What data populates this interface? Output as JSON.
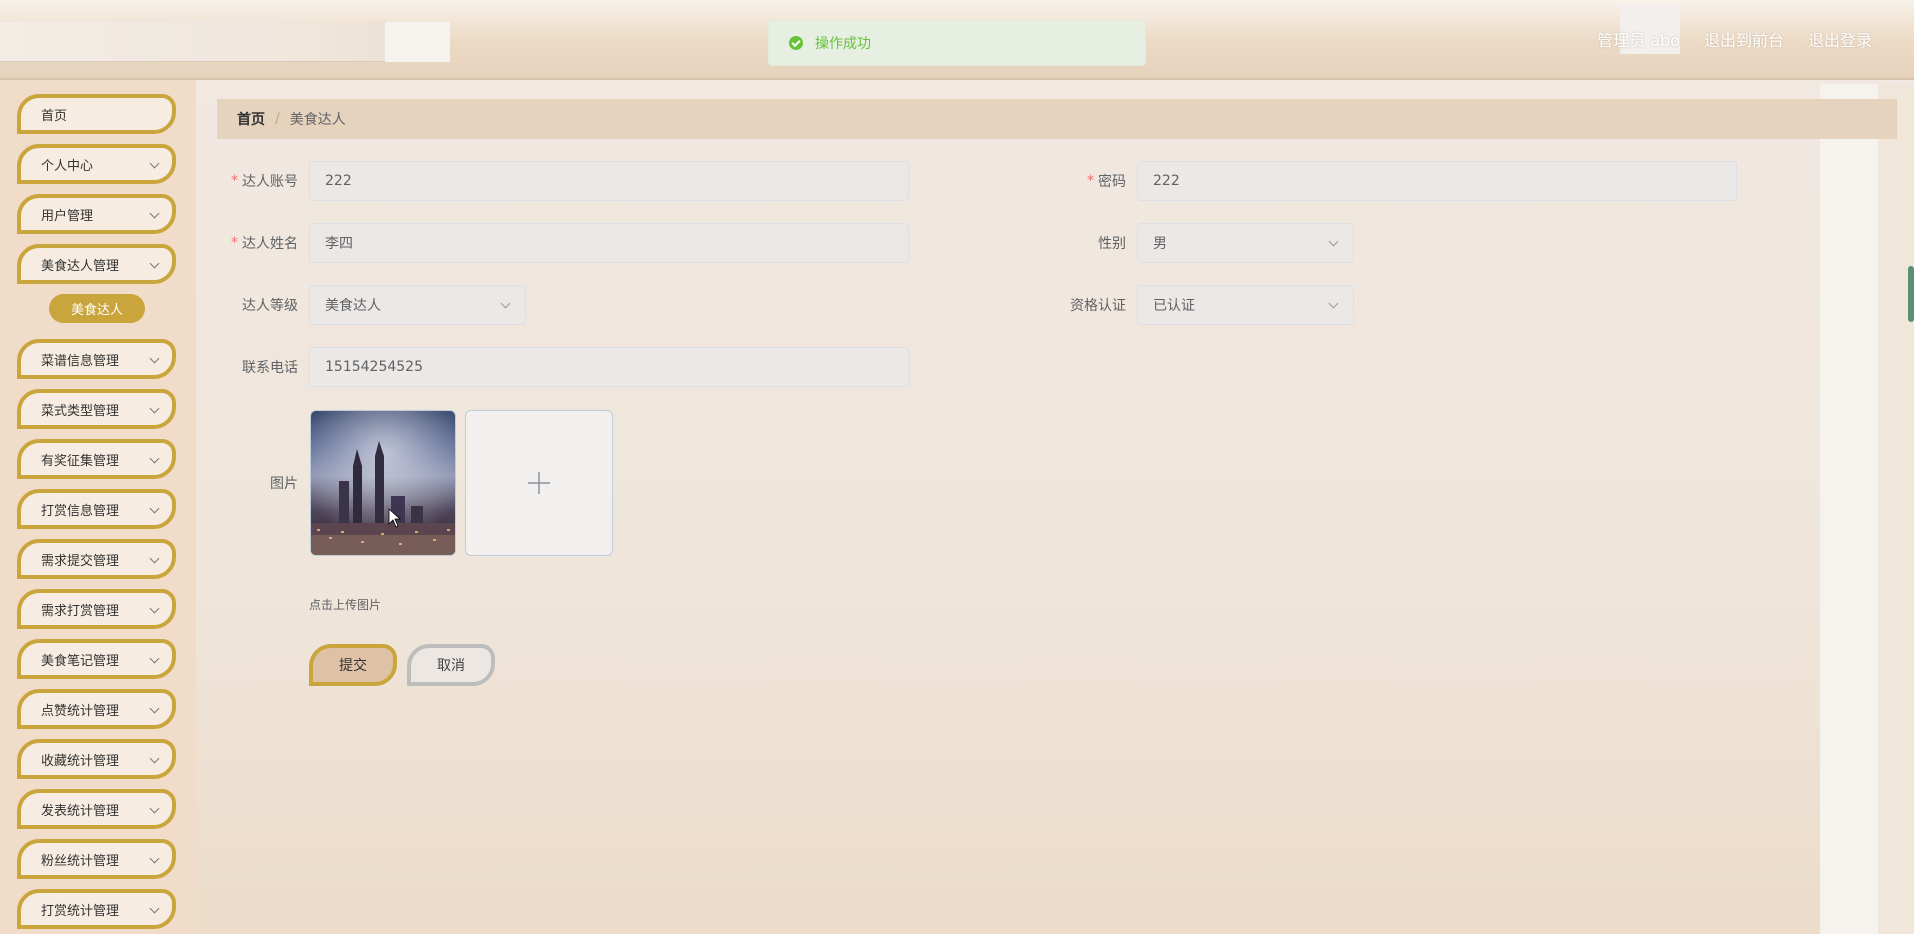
{
  "header": {
    "toast_message": "操作成功",
    "admin_label": "管理员 abo",
    "to_front_label": "退出到前台",
    "logout_label": "退出登录"
  },
  "sidebar": {
    "items": [
      {
        "label": "首页"
      },
      {
        "label": "个人中心"
      },
      {
        "label": "用户管理"
      },
      {
        "label": "美食达人管理"
      },
      {
        "label": "菜谱信息管理"
      },
      {
        "label": "菜式类型管理"
      },
      {
        "label": "有奖征集管理"
      },
      {
        "label": "打赏信息管理"
      },
      {
        "label": "需求提交管理"
      },
      {
        "label": "需求打赏管理"
      },
      {
        "label": "美食笔记管理"
      },
      {
        "label": "点赞统计管理"
      },
      {
        "label": "收藏统计管理"
      },
      {
        "label": "发表统计管理"
      },
      {
        "label": "粉丝统计管理"
      },
      {
        "label": "打赏统计管理"
      }
    ],
    "active_sub": "美食达人"
  },
  "breadcrumb": {
    "home": "首页",
    "separator": "/",
    "current": "美食达人"
  },
  "form": {
    "account_label": "达人账号",
    "account_value": "222",
    "password_label": "密码",
    "password_value": "222",
    "name_label": "达人姓名",
    "name_value": "李四",
    "gender_label": "性别",
    "gender_value": "男",
    "level_label": "达人等级",
    "level_value": "美食达人",
    "cert_label": "资格认证",
    "cert_value": "已认证",
    "phone_label": "联系电话",
    "phone_value": "15154254525",
    "image_label": "图片",
    "upload_tip": "点击上传图片",
    "submit_label": "提交",
    "cancel_label": "取消"
  }
}
